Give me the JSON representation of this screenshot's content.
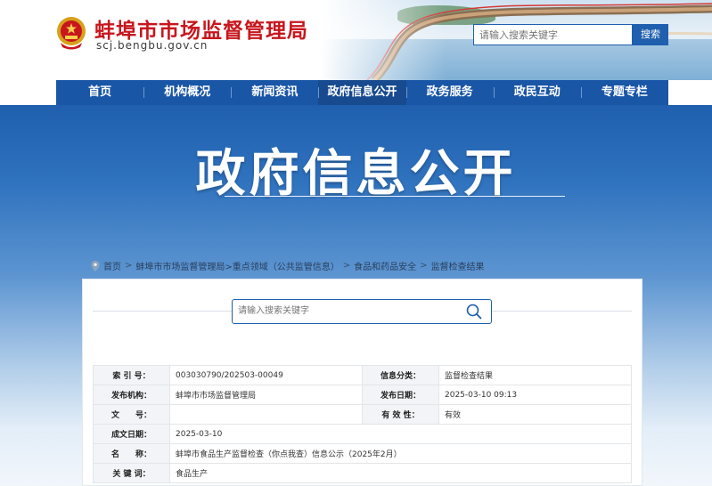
{
  "site": {
    "title": "蚌埠市市场监督管理局",
    "domain": "scj.bengbu.gov.cn"
  },
  "top_search": {
    "placeholder": "请输入搜索关键字",
    "button": "搜索"
  },
  "nav": [
    {
      "label": "首页"
    },
    {
      "label": "机构概况"
    },
    {
      "label": "新闻资讯"
    },
    {
      "label": "政府信息公开",
      "active": true
    },
    {
      "label": "政务服务"
    },
    {
      "label": "政民互动"
    },
    {
      "label": "专题专栏"
    }
  ],
  "banner": {
    "title": "政府信息公开"
  },
  "breadcrumb": [
    "首页",
    "蚌埠市市场监督管理局",
    ">重点领域（公共监管信息）",
    "食品和药品安全",
    "监督检查结果"
  ],
  "content_search": {
    "placeholder": "请输入搜索关键字"
  },
  "info_table": {
    "index_label": "索 引 号：",
    "index_value": "003030790/202503-00049",
    "category_label": "信息分类：",
    "category_value": "监督检查结果",
    "publisher_label": "发布机构：",
    "publisher_value": "蚌埠市市场监督管理局",
    "publish_date_label": "发布日期：",
    "publish_date_value": "2025-03-10 09:13",
    "docno_label": "文　　号：",
    "docno_value": "",
    "validity_label": "有 效 性：",
    "validity_value": "有效",
    "created_label": "成文日期：",
    "created_value": "2025-03-10",
    "name_label": "名　　称：",
    "name_value": "蚌埠市食品生产监督检查（你点我查）信息公示（2025年2月）",
    "keywords_label": "关 键 词：",
    "keywords_value": "食品生产"
  },
  "colors": {
    "brand_red": "#c8161d",
    "nav_blue": "#1a56a6",
    "accent_blue": "#1f5fae"
  },
  "icons": {
    "emblem": "national-emblem-icon",
    "location": "location-pin-icon",
    "search": "search-icon"
  }
}
